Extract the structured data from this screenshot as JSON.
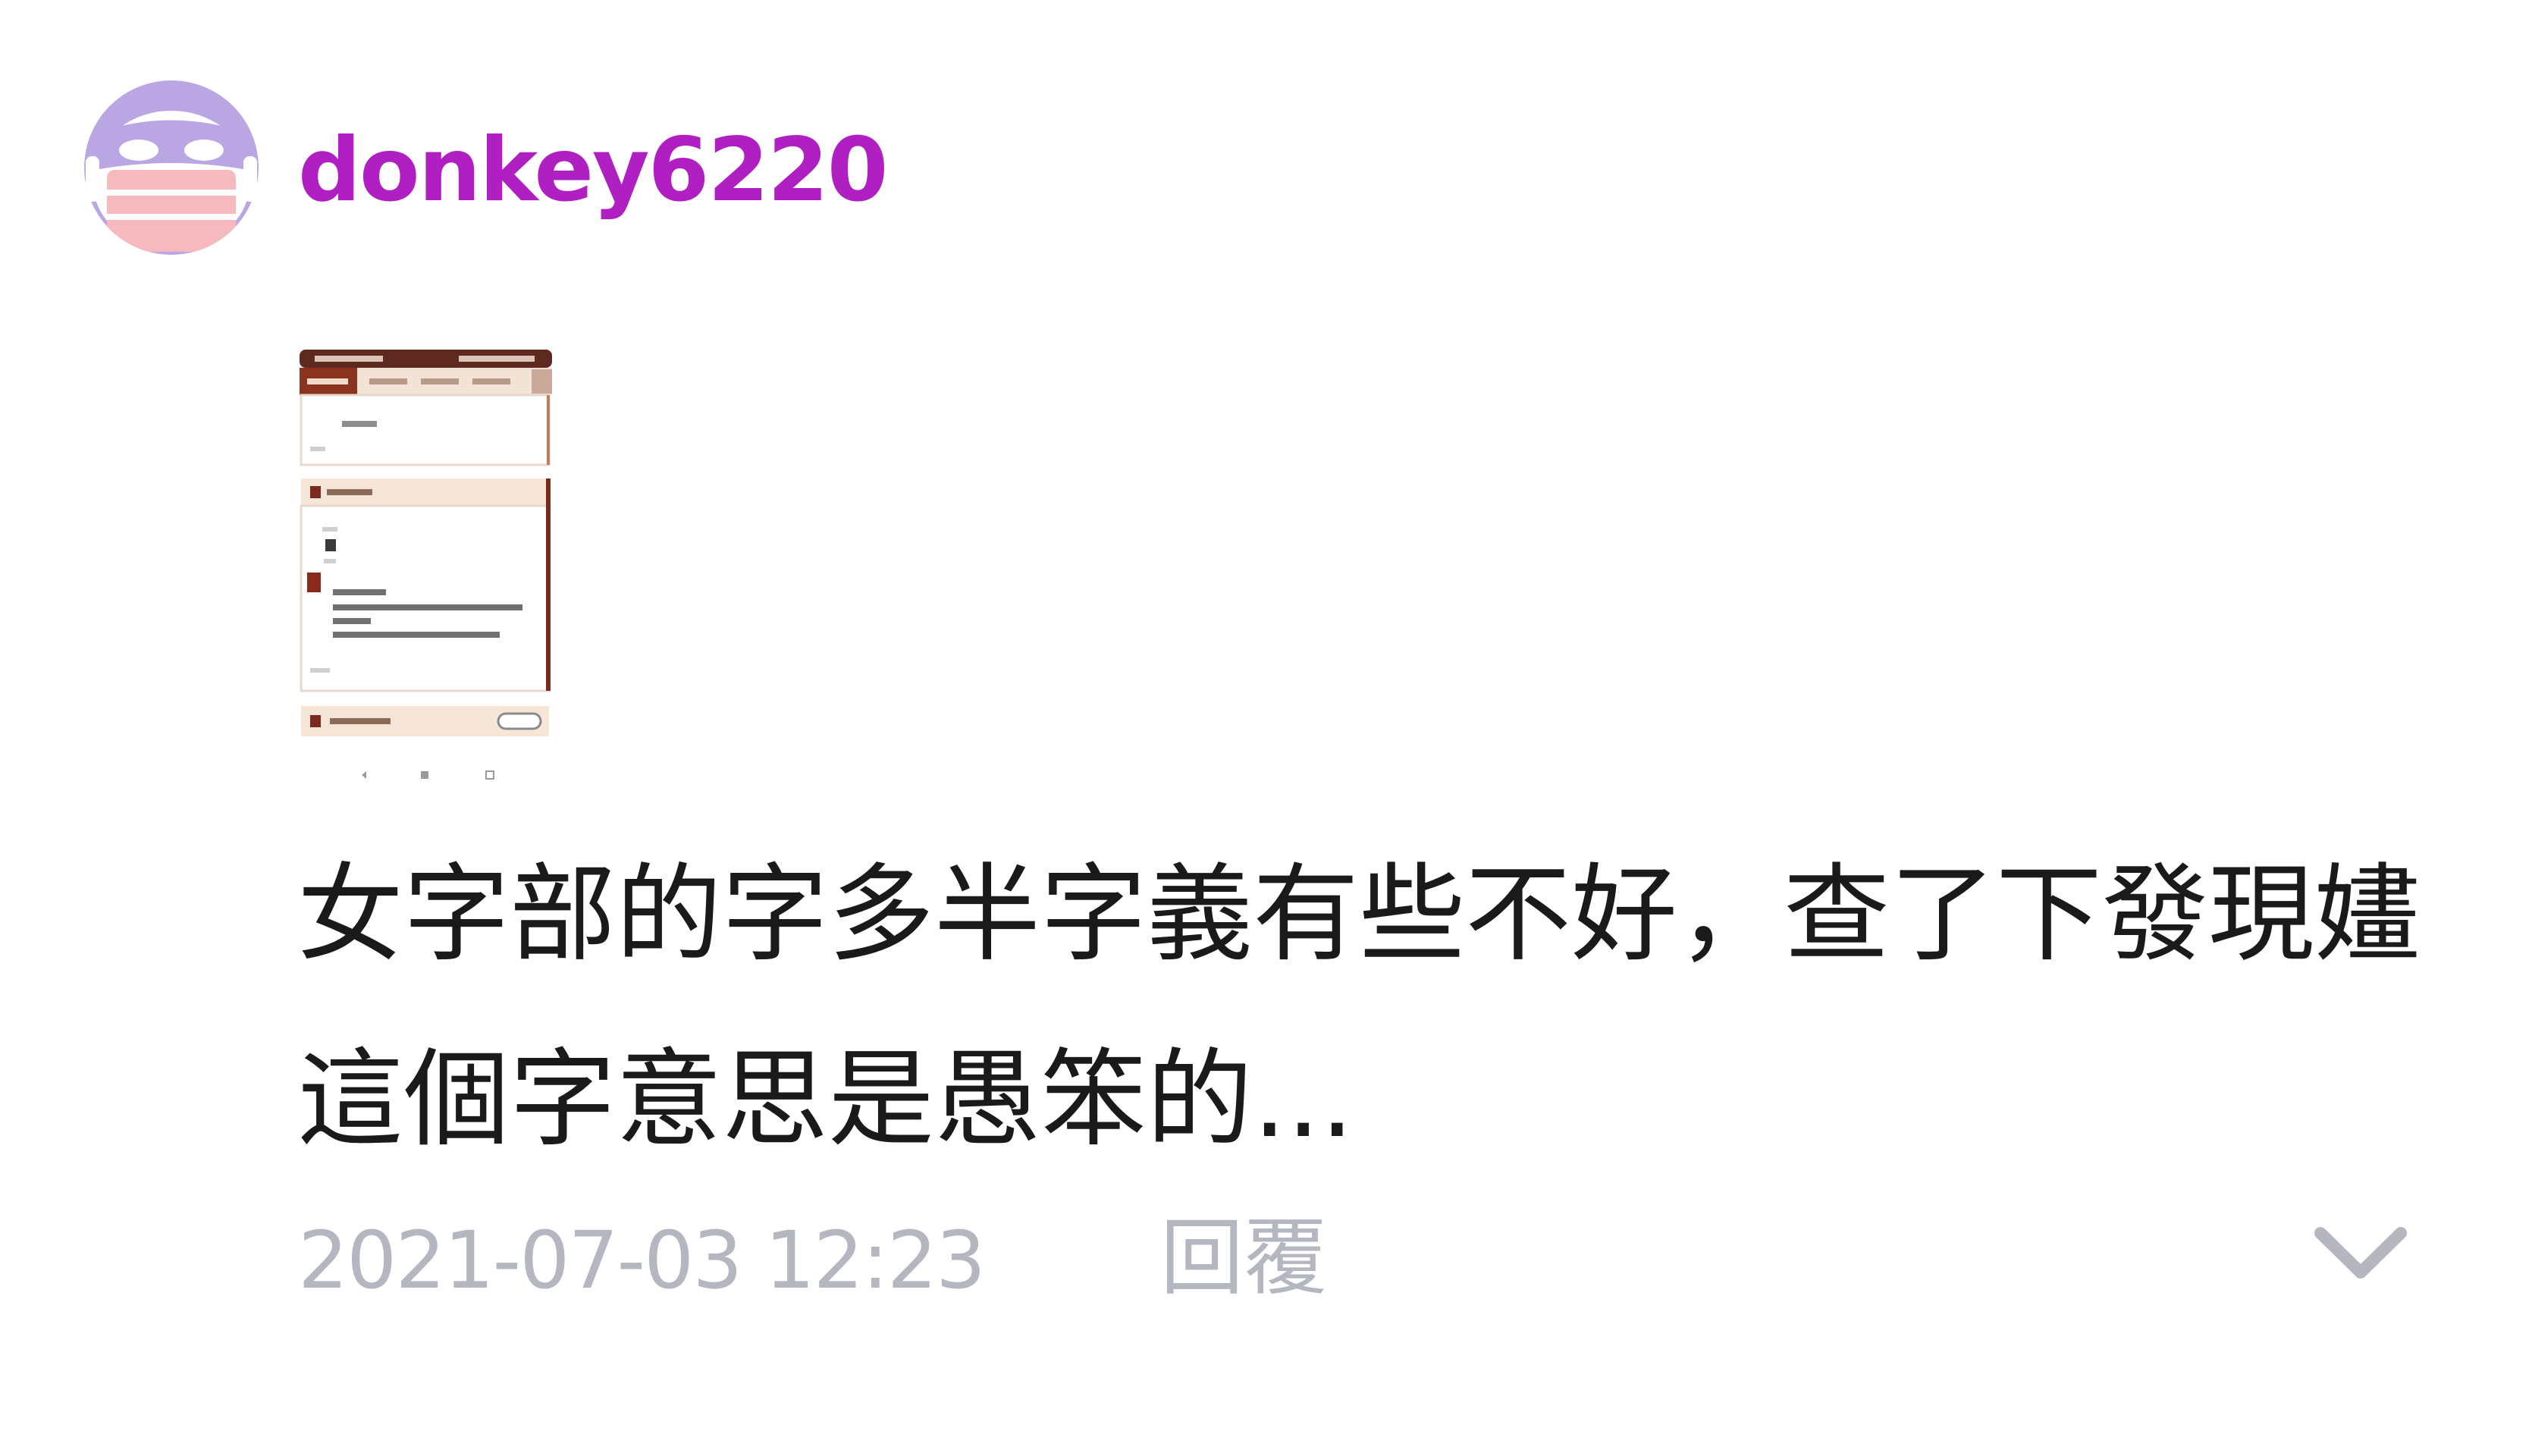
{
  "comment": {
    "username": "donkey6220",
    "text": "女字部的字多半字義有些不好，查了下發現嫿這個字意思是愚笨的...",
    "timestamp": "2021-07-03 12:23",
    "reply_label": "回覆",
    "avatar": {
      "icon": "masked-face-avatar-icon",
      "background": "#b9a6e3",
      "mask_color": "#f6b9bd",
      "face_color": "#ffffff"
    },
    "attachment_icon": "dictionary-app-screenshot-thumbnail",
    "expand_icon": "chevron-down-icon"
  },
  "colors": {
    "username": "#b01fc2",
    "text": "#1a1a1a",
    "meta": "#b4b6c0",
    "thumbnail_accent": "#7a2a1e"
  }
}
